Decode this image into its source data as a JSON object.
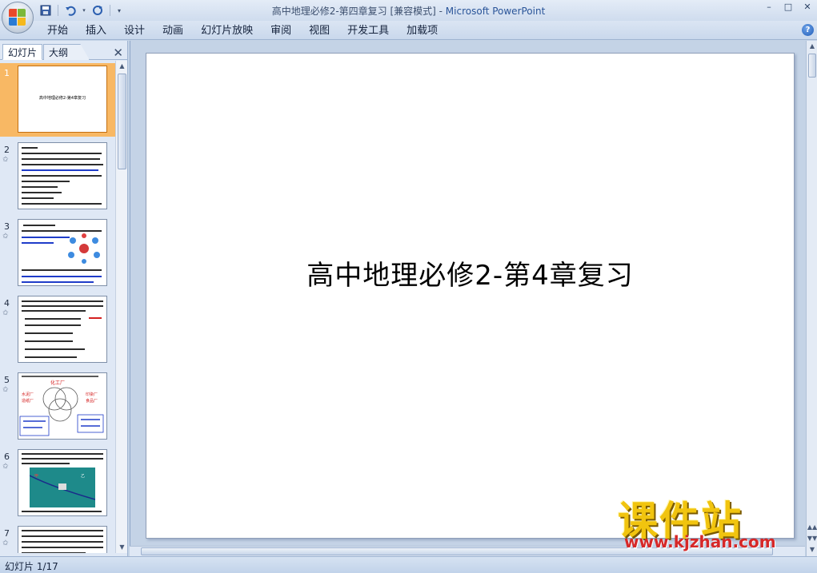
{
  "window": {
    "title": "高中地理必修2-第四章复习 [兼容模式] - ",
    "app_name": "Microsoft PowerPoint",
    "controls": [
      "–",
      "□",
      "✕"
    ]
  },
  "qat": {
    "icons": [
      "save-icon",
      "undo-icon",
      "redo-icon",
      "customize-icon"
    ]
  },
  "ribbon": {
    "tabs": [
      "开始",
      "插入",
      "设计",
      "动画",
      "幻灯片放映",
      "审阅",
      "视图",
      "开发工具",
      "加载项"
    ],
    "help": "?"
  },
  "panel": {
    "tab_slides": "幻灯片",
    "tab_outline": "大纲",
    "close": "✕"
  },
  "thumbnails": [
    {
      "num": "1",
      "selected": true,
      "title": "高中地理必修2-第4章复习"
    },
    {
      "num": "2",
      "selected": false
    },
    {
      "num": "3",
      "selected": false
    },
    {
      "num": "4",
      "selected": false
    },
    {
      "num": "5",
      "selected": false
    },
    {
      "num": "6",
      "selected": false
    },
    {
      "num": "7",
      "selected": false
    }
  ],
  "slide": {
    "title": "高中地理必修2-第4章复习"
  },
  "status": {
    "text": "幻灯片 1/17"
  },
  "watermark": {
    "big": "课件站",
    "url": "www.kjzhan.com"
  },
  "colors": {
    "selected_thumb": "#f8b864",
    "ribbon_bg": "#dbe5f3",
    "workspace_bg": "#c4d3e6",
    "accent": "#2a5599"
  }
}
